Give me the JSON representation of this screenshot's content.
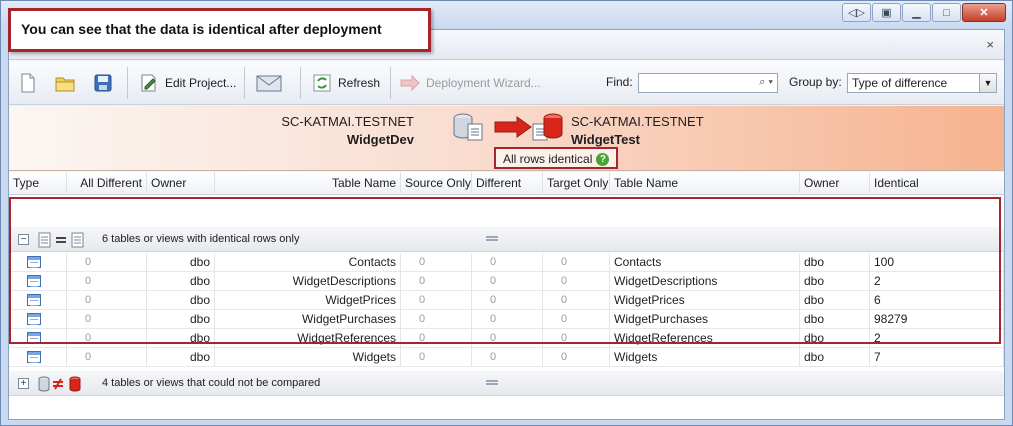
{
  "callout": {
    "text": "You can see that the data is identical after deployment"
  },
  "window": {
    "close_label": "×"
  },
  "toolbar": {
    "edit_project": "Edit Project...",
    "refresh": "Refresh",
    "deployment_wizard": "Deployment Wizard...",
    "find_label": "Find:",
    "find_value": "",
    "group_by_label": "Group by:",
    "group_by_value": "Type of difference"
  },
  "banner": {
    "source_server": "SC-KATMAI.TESTNET",
    "source_db": "WidgetDev",
    "target_server": "SC-KATMAI.TESTNET",
    "target_db": "WidgetTest",
    "status": "All rows identical"
  },
  "grid": {
    "headers": [
      "Type",
      "All Different",
      "Owner",
      "Table Name",
      "Source Only",
      "Different",
      "Target Only",
      "Table Name",
      "Owner",
      "Identical"
    ],
    "group1_label": "6 tables or views with identical rows only",
    "group2_label": "4 tables or views that could not be compared",
    "rows": [
      {
        "all_different": "0",
        "owner": "dbo",
        "table_name": "Contacts",
        "source_only": "0",
        "different": "0",
        "target_only": "0",
        "target_table": "Contacts",
        "target_owner": "dbo",
        "identical": "100"
      },
      {
        "all_different": "0",
        "owner": "dbo",
        "table_name": "WidgetDescriptions",
        "source_only": "0",
        "different": "0",
        "target_only": "0",
        "target_table": "WidgetDescriptions",
        "target_owner": "dbo",
        "identical": "2"
      },
      {
        "all_different": "0",
        "owner": "dbo",
        "table_name": "WidgetPrices",
        "source_only": "0",
        "different": "0",
        "target_only": "0",
        "target_table": "WidgetPrices",
        "target_owner": "dbo",
        "identical": "6"
      },
      {
        "all_different": "0",
        "owner": "dbo",
        "table_name": "WidgetPurchases",
        "source_only": "0",
        "different": "0",
        "target_only": "0",
        "target_table": "WidgetPurchases",
        "target_owner": "dbo",
        "identical": "98279"
      },
      {
        "all_different": "0",
        "owner": "dbo",
        "table_name": "WidgetReferences",
        "source_only": "0",
        "different": "0",
        "target_only": "0",
        "target_table": "WidgetReferences",
        "target_owner": "dbo",
        "identical": "2"
      },
      {
        "all_different": "0",
        "owner": "dbo",
        "table_name": "Widgets",
        "source_only": "0",
        "different": "0",
        "target_only": "0",
        "target_table": "Widgets",
        "target_owner": "dbo",
        "identical": "7"
      }
    ]
  },
  "colors": {
    "highlight": "#a6242c",
    "banner_end": "#f6b38f"
  }
}
